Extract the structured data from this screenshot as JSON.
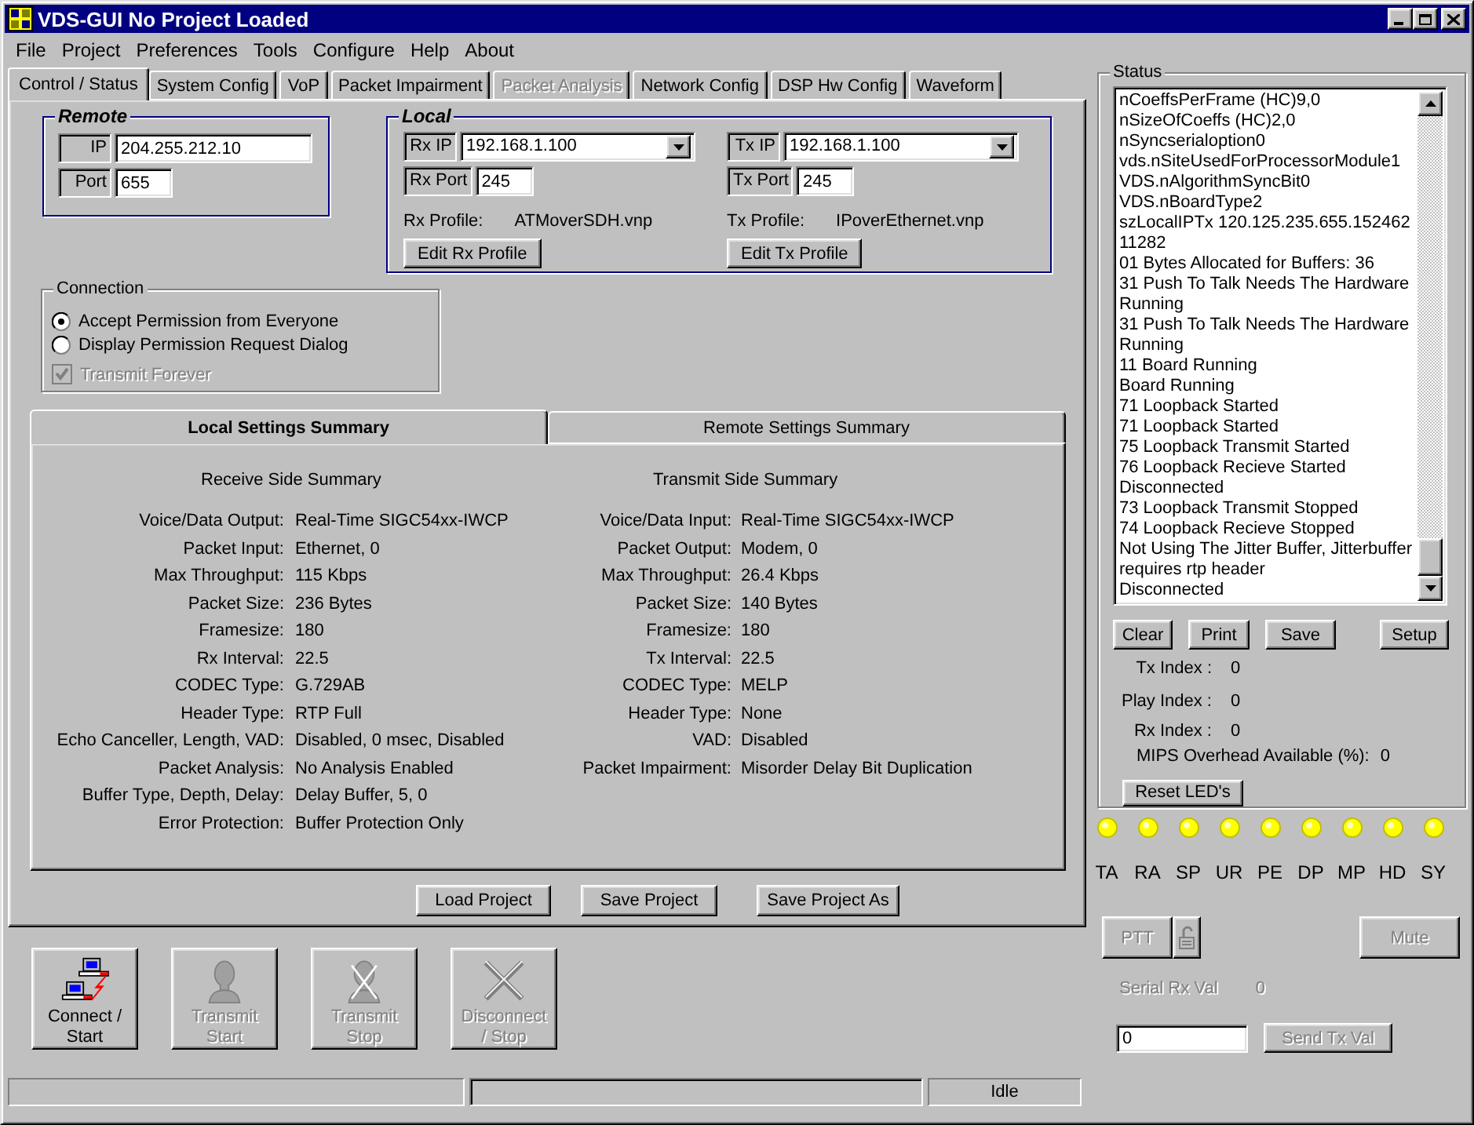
{
  "window": {
    "title": "VDS-GUI No Project Loaded"
  },
  "menu": [
    "File",
    "Project",
    "Preferences",
    "Tools",
    "Configure",
    "Help",
    "About"
  ],
  "tabs": [
    {
      "label": "Control / Status",
      "selected": true,
      "disabled": false
    },
    {
      "label": "System Config",
      "selected": false,
      "disabled": false
    },
    {
      "label": "VoP",
      "selected": false,
      "disabled": false
    },
    {
      "label": "Packet Impairment",
      "selected": false,
      "disabled": false
    },
    {
      "label": "Packet Analysis",
      "selected": false,
      "disabled": true
    },
    {
      "label": "Network Config",
      "selected": false,
      "disabled": false
    },
    {
      "label": "DSP Hw Config",
      "selected": false,
      "disabled": false
    },
    {
      "label": "Waveform",
      "selected": false,
      "disabled": false
    }
  ],
  "remote": {
    "title": "Remote",
    "fields": [
      {
        "label": "IP",
        "value": "204.255.212.10"
      },
      {
        "label": "Port",
        "value": "655"
      }
    ]
  },
  "local": {
    "title": "Local",
    "sides": [
      {
        "ip_label": "Rx IP",
        "ip": "192.168.1.100",
        "port_label": "Rx Port",
        "port": "245",
        "profile_label": "Rx Profile:",
        "profile": "ATMoverSDH.vnp",
        "edit_button": "Edit Rx Profile"
      },
      {
        "ip_label": "Tx IP",
        "ip": "192.168.1.100",
        "port_label": "Tx Port",
        "port": "245",
        "profile_label": "Tx Profile:",
        "profile": "IPoverEthernet.vnp",
        "edit_button": "Edit Tx Profile"
      }
    ]
  },
  "connection": {
    "title": "Connection",
    "options": [
      {
        "label": "Accept Permission from Everyone",
        "selected": true
      },
      {
        "label": "Display Permission Request Dialog",
        "selected": false
      }
    ],
    "transmit_forever": {
      "label": "Transmit Forever",
      "checked": true,
      "disabled": true
    }
  },
  "summary": {
    "tabs": [
      {
        "label": "Local Settings Summary",
        "selected": true
      },
      {
        "label": "Remote Settings Summary",
        "selected": false
      }
    ],
    "sides": [
      {
        "heading": "Receive Side Summary",
        "rows": [
          {
            "label": "Voice/Data Output:",
            "value": "Real-Time SIGC54xx-IWCP"
          },
          {
            "label": "Packet Input:",
            "value": "Ethernet, 0"
          },
          {
            "label": "Max Throughput:",
            "value": "115 Kbps"
          },
          {
            "label": "Packet Size:",
            "value": "236 Bytes"
          },
          {
            "label": "Framesize:",
            "value": "180"
          },
          {
            "label": "Rx Interval:",
            "value": "22.5"
          },
          {
            "label": "CODEC Type:",
            "value": "G.729AB"
          },
          {
            "label": "Header Type:",
            "value": "RTP Full"
          },
          {
            "label": "Echo Canceller, Length, VAD:",
            "value": "Disabled, 0 msec, Disabled"
          },
          {
            "label": "Packet Analysis:",
            "value": "No Analysis Enabled"
          },
          {
            "label": "Buffer Type, Depth, Delay:",
            "value": "Delay Buffer, 5, 0"
          },
          {
            "label": "Error Protection:",
            "value": "Buffer Protection Only"
          }
        ]
      },
      {
        "heading": "Transmit Side Summary",
        "rows": [
          {
            "label": "Voice/Data Input:",
            "value": "Real-Time SIGC54xx-IWCP"
          },
          {
            "label": "Packet Output:",
            "value": "Modem, 0"
          },
          {
            "label": "Max Throughput:",
            "value": "26.4 Kbps"
          },
          {
            "label": "Packet Size:",
            "value": "140 Bytes"
          },
          {
            "label": "Framesize:",
            "value": "180"
          },
          {
            "label": "Tx Interval:",
            "value": "22.5"
          },
          {
            "label": "CODEC Type:",
            "value": "MELP"
          },
          {
            "label": "Header Type:",
            "value": "None"
          },
          {
            "label": "VAD:",
            "value": "Disabled"
          },
          {
            "label": "Packet Impairment:",
            "value": "Misorder Delay Bit Duplication"
          }
        ]
      }
    ]
  },
  "project_buttons": [
    "Load Project",
    "Save Project",
    "Save Project As"
  ],
  "actions": [
    {
      "kind": "connect",
      "label": [
        "Connect /",
        "Start"
      ],
      "disabled": false
    },
    {
      "kind": "transmit_start",
      "label": [
        "Transmit",
        "Start"
      ],
      "disabled": true
    },
    {
      "kind": "transmit_stop",
      "label": [
        "Transmit",
        "Stop"
      ],
      "disabled": true
    },
    {
      "kind": "disconnect",
      "label": [
        "Disconnect",
        "/ Stop"
      ],
      "disabled": true
    }
  ],
  "status_bar": {
    "progress": {
      "level": 0
    },
    "state": "Idle"
  },
  "status": {
    "title": "Status",
    "log": [
      "nCoeffsPerFrame (HC)9,0",
      "nSizeOfCoeffs (HC)2,0",
      "nSyncserialoption0",
      "vds.nSiteUsedForProcessorModule1",
      "VDS.nAlgorithmSyncBit0",
      "VDS.nBoardType2",
      "szLocalIPTx 120.125.235.655.152462",
      "11282",
      "01 Bytes Allocated for Buffers: 36",
      "31 Push To Talk Needs The Hardware Running",
      "31 Push To Talk Needs The Hardware Running",
      "11 Board Running",
      "Board Running",
      "71 Loopback Started",
      "71 Loopback Started",
      "75 Loopback Transmit Started",
      "76 Loopback Recieve Started",
      "Disconnected",
      "73 Loopback Transmit Stopped",
      "74 Loopback Recieve Stopped",
      "Not Using The Jitter Buffer, Jitterbuffer requires rtp header",
      "Disconnected"
    ],
    "buttons": [
      "Clear",
      "Print",
      "Save",
      "Setup"
    ],
    "indexes": [
      {
        "label": "Tx Index :",
        "value": "0"
      },
      {
        "label": "Play Index :",
        "value": "0"
      },
      {
        "label": "Rx Index :",
        "value": "0"
      }
    ],
    "mips": {
      "label": "MIPS Overhead Available (%):",
      "value": "0"
    },
    "reset_button": "Reset LED's"
  },
  "leds": [
    {
      "label": "TA",
      "on": true
    },
    {
      "label": "RA",
      "on": true
    },
    {
      "label": "SP",
      "on": true
    },
    {
      "label": "UR",
      "on": true
    },
    {
      "label": "PE",
      "on": true
    },
    {
      "label": "DP",
      "on": true
    },
    {
      "label": "MP",
      "on": true
    },
    {
      "label": "HD",
      "on": true
    },
    {
      "label": "SY",
      "on": true
    }
  ],
  "controls": {
    "ptt": {
      "label": "PTT",
      "disabled": true
    },
    "mute": {
      "label": "Mute",
      "disabled": true
    },
    "serial_rx": {
      "label": "Serial Rx Val",
      "value": "0",
      "disabled": true
    },
    "tx_value": "0",
    "send_button": {
      "label": "Send Tx Val",
      "disabled": true
    }
  }
}
